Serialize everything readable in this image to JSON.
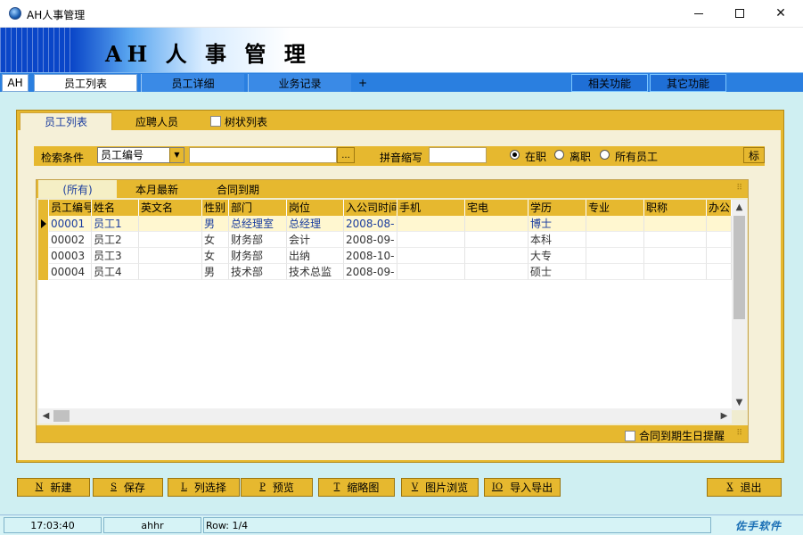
{
  "window": {
    "title": "AH人事管理",
    "icon": "globe-icon"
  },
  "banner": {
    "title": "AH 人 事 管 理"
  },
  "menu_tabs": {
    "ah": "AH",
    "items": [
      "员工列表",
      "员工详细",
      "业务记录"
    ],
    "plus": "+",
    "right": [
      "相关功能",
      "其它功能"
    ]
  },
  "inner_tabs": {
    "employee_list": "员工列表",
    "applicants": "应聘人员",
    "tree_list": "树状列表"
  },
  "search": {
    "label": "检索条件",
    "field_selected": "员工编号",
    "value": "",
    "browse": "...",
    "pinyin_label": "拼音缩写",
    "pinyin_value": "",
    "filters": [
      "在职",
      "离职",
      "所有员工"
    ],
    "filter_selected": "在职",
    "side_button": "标"
  },
  "grid_tabs": [
    "(所有)",
    "本月最新",
    "合同到期"
  ],
  "grid": {
    "columns": [
      "员工编号",
      "姓名",
      "英文名",
      "性别",
      "部门",
      "岗位",
      "入公司时间",
      "手机",
      "宅电",
      "学历",
      "专业",
      "职称",
      "办公"
    ],
    "rows": [
      [
        "00001",
        "员工1",
        "",
        "男",
        "总经理室",
        "总经理",
        "2008-08-",
        "",
        "",
        "博士",
        "",
        "",
        ""
      ],
      [
        "00002",
        "员工2",
        "",
        "女",
        "财务部",
        "会计",
        "2008-09-",
        "",
        "",
        "本科",
        "",
        "",
        ""
      ],
      [
        "00003",
        "员工3",
        "",
        "女",
        "财务部",
        "出纳",
        "2008-10-",
        "",
        "",
        "大专",
        "",
        "",
        ""
      ],
      [
        "00004",
        "员工4",
        "",
        "男",
        "技术部",
        "技术总监",
        "2008-09-",
        "",
        "",
        "硕士",
        "",
        "",
        ""
      ]
    ],
    "selected_row": 0
  },
  "grid_footer": {
    "reminder_label": "合同到期生日提醒"
  },
  "buttons": [
    {
      "key": "N",
      "label": "新建"
    },
    {
      "key": "S",
      "label": "保存"
    },
    {
      "key": "L",
      "label": "列选择"
    },
    {
      "key": "P",
      "label": "预览"
    },
    {
      "key": "T",
      "label": "缩略图"
    },
    {
      "key": "V",
      "label": "图片浏览"
    },
    {
      "key": "IO",
      "label": "导入导出"
    },
    {
      "key": "X",
      "label": "退出"
    }
  ],
  "status": {
    "time": "17:03:40",
    "user": "ahhr",
    "row": "Row: 1/4",
    "brand": "佐手软件"
  },
  "colors": {
    "accent": "#e6b82f",
    "menu_blue": "#2a7fe0",
    "background": "#cfeff2"
  }
}
